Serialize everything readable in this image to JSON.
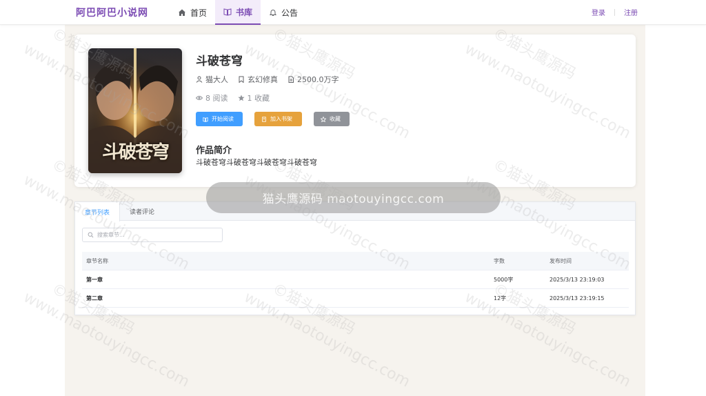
{
  "header": {
    "logo": "阿巴阿巴小说网",
    "nav": [
      {
        "label": "首页",
        "icon": "home-icon"
      },
      {
        "label": "书库",
        "icon": "book-icon"
      },
      {
        "label": "公告",
        "icon": "bell-icon"
      }
    ],
    "active_nav": "书库",
    "login": "登录",
    "register": "注册"
  },
  "book": {
    "title": "斗破苍穹",
    "cover_text": "斗破苍穹",
    "author": "猫大人",
    "category": "玄幻修真",
    "words": "2500.0万字",
    "reads": "8 阅读",
    "favorites": "1 收藏",
    "buttons": {
      "read": "开始阅读",
      "shelf": "加入书架",
      "favorite": "收藏"
    },
    "intro_heading": "作品简介",
    "intro": "斗破苍穹斗破苍穹斗破苍穹斗破苍穹"
  },
  "overlay": "猫头鹰源码 maotouyingcc.com",
  "watermark": {
    "cn": "©猫头鹰源码",
    "en": "www.maotouyingcc.com"
  },
  "chapters": {
    "tabs": [
      "章节列表",
      "读者评论"
    ],
    "active_tab": "章节列表",
    "search_placeholder": "搜索章节...",
    "columns": [
      "章节名称",
      "字数",
      "发布时间"
    ],
    "rows": [
      {
        "name": "第一章",
        "words": "5000字",
        "time": "2025/3/13 23:19:03"
      },
      {
        "name": "第二章",
        "words": "12字",
        "time": "2025/3/13 23:19:15"
      }
    ]
  },
  "colors": {
    "accent": "#7b4bb3",
    "primary": "#409eff",
    "warning": "#e6a23c",
    "info": "#909399"
  }
}
